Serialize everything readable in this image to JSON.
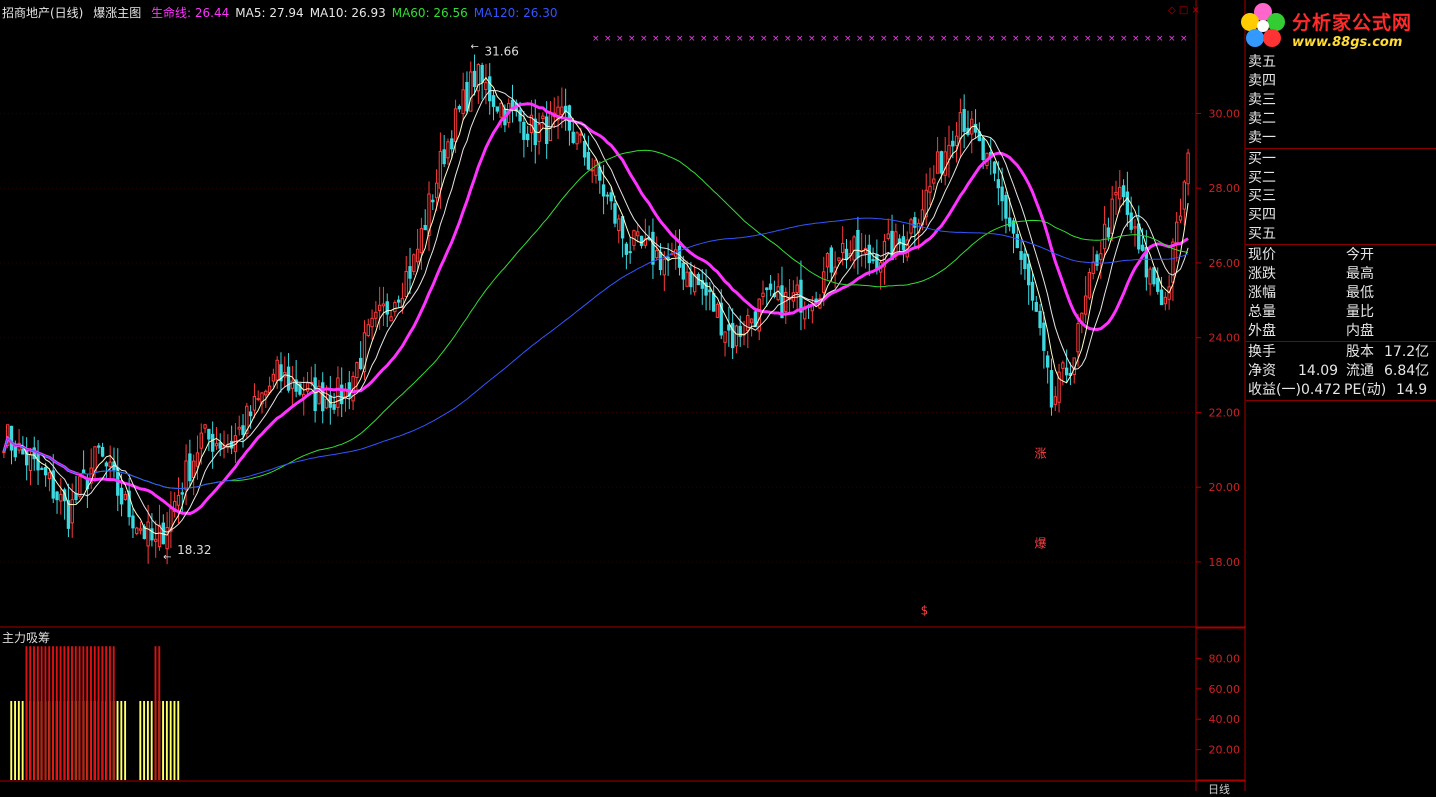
{
  "header": {
    "stock_name": "招商地产(日线)",
    "indicator_name": "爆涨主图",
    "items": [
      {
        "label": "生命线:",
        "value": "26.44",
        "color": "#ff33ff"
      },
      {
        "label": "MA5:",
        "value": "27.94",
        "color": "#e6e6e6"
      },
      {
        "label": "MA10:",
        "value": "26.93",
        "color": "#e6e6e6"
      },
      {
        "label": "MA60:",
        "value": "26.56",
        "color": "#33dd33"
      },
      {
        "label": "MA120:",
        "value": "26.30",
        "color": "#3355ff"
      }
    ]
  },
  "sub_indicator": {
    "title": "主力吸筹"
  },
  "logo": {
    "line1": "分析家公式网",
    "line2": "www.88gs.com"
  },
  "quote_panel": {
    "sell": [
      "卖五",
      "卖四",
      "卖三",
      "卖二",
      "卖一"
    ],
    "buy": [
      "买一",
      "买二",
      "买三",
      "买四",
      "买五"
    ],
    "stats_left": [
      "现价",
      "涨跌",
      "涨幅",
      "总量",
      "外盘"
    ],
    "stats_right": [
      "今开",
      "最高",
      "最低",
      "量比",
      "内盘"
    ],
    "info": [
      {
        "l1": "换手",
        "v1": "",
        "l2": "股本",
        "v2": "17.2亿"
      },
      {
        "l1": "净资",
        "v1": "14.09",
        "l2": "流通",
        "v2": "6.84亿"
      },
      {
        "l1": "收益(一)",
        "v1": "0.472",
        "l2": "PE(动)",
        "v2": "14.9"
      }
    ]
  },
  "period_label": "日线",
  "chart_data": [
    {
      "type": "candlestick",
      "title": "招商地产(日线) 爆涨主图",
      "ylim": [
        16.5,
        32.5
      ],
      "y_ticks": [
        18.0,
        20.0,
        22.0,
        24.0,
        26.0,
        28.0,
        30.0
      ],
      "y_tick_labels": [
        "18.00",
        "20.00",
        "22.00",
        "24.00",
        "26.00",
        "28.00",
        "30.00"
      ],
      "annotations": [
        {
          "text": "31.66",
          "type": "high",
          "value": 31.66
        },
        {
          "text": "18.32",
          "type": "low",
          "value": 18.32
        },
        {
          "text": "涨",
          "value": 20.9
        },
        {
          "text": "爆",
          "value": 18.5
        },
        {
          "text": "$",
          "value": 16.7
        }
      ],
      "markers_count": 50,
      "anchors": [
        [
          0,
          21.4
        ],
        [
          12,
          20.1
        ],
        [
          17,
          19.3
        ],
        [
          25,
          20.9
        ],
        [
          32,
          19.5
        ],
        [
          40,
          18.4
        ],
        [
          52,
          21.3
        ],
        [
          60,
          21.2
        ],
        [
          72,
          23.0
        ],
        [
          82,
          22.4
        ],
        [
          90,
          22.5
        ],
        [
          96,
          24.0
        ],
        [
          108,
          26.0
        ],
        [
          116,
          29.0
        ],
        [
          124,
          31.0
        ],
        [
          132,
          30.1
        ],
        [
          140,
          29.5
        ],
        [
          148,
          29.8
        ],
        [
          156,
          28.4
        ],
        [
          164,
          26.5
        ],
        [
          172,
          26.2
        ],
        [
          180,
          25.8
        ],
        [
          186,
          25.0
        ],
        [
          192,
          24.0
        ],
        [
          200,
          24.9
        ],
        [
          208,
          25.0
        ],
        [
          214,
          25.3
        ],
        [
          220,
          26.4
        ],
        [
          228,
          26.1
        ],
        [
          236,
          26.5
        ],
        [
          244,
          28.0
        ],
        [
          252,
          30.1
        ],
        [
          260,
          28.4
        ],
        [
          266,
          26.8
        ],
        [
          272,
          24.5
        ],
        [
          276,
          22.2
        ],
        [
          282,
          23.6
        ],
        [
          288,
          26.2
        ],
        [
          294,
          27.9
        ],
        [
          300,
          26.0
        ],
        [
          306,
          25.0
        ],
        [
          312,
          28.6
        ]
      ],
      "series": [
        {
          "name": "生命线",
          "value": 26.44,
          "color": "#ff33ff",
          "period": 20
        },
        {
          "name": "MA5",
          "value": 27.94,
          "color": "#ffffcc",
          "period": 5
        },
        {
          "name": "MA10",
          "value": 26.93,
          "color": "#e6e6e6",
          "period": 10
        },
        {
          "name": "MA60",
          "value": 26.56,
          "color": "#33dd33",
          "period": 60
        },
        {
          "name": "MA120",
          "value": 26.3,
          "color": "#3355ff",
          "period": 120
        }
      ]
    },
    {
      "type": "bar",
      "title": "主力吸筹",
      "ylim": [
        0,
        100
      ],
      "y_ticks": [
        20,
        40,
        60,
        80
      ],
      "y_tick_labels": [
        "20.00",
        "40.00",
        "60.00",
        "80.00"
      ],
      "series": [
        {
          "name": "",
          "color": "#ffff66",
          "segments": [
            [
              2,
              32,
              52
            ],
            [
              36,
              46,
              52
            ]
          ]
        },
        {
          "name": "",
          "color": "#dd1111",
          "segments": [
            [
              6,
              29,
              88
            ],
            [
              40,
              41,
              88
            ]
          ]
        }
      ]
    }
  ]
}
